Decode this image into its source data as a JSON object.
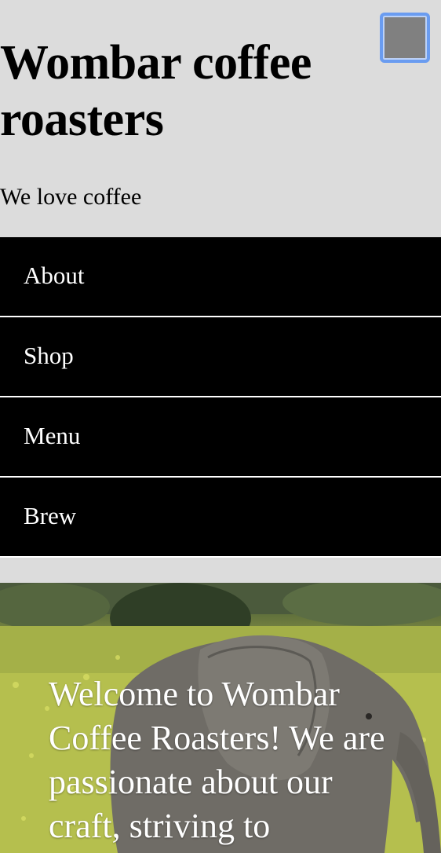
{
  "header": {
    "title": "Wombar coffee roasters",
    "tagline": "We love coffee",
    "menu_toggle_icon": "menu-toggle-icon"
  },
  "nav": {
    "items": [
      {
        "label": "About"
      },
      {
        "label": "Shop"
      },
      {
        "label": "Menu"
      },
      {
        "label": "Brew"
      }
    ]
  },
  "hero": {
    "image_icon": "elephant-photo",
    "text": "Welcome to Wombar Coffee Roasters! We are passionate about our craft, striving to"
  },
  "colors": {
    "page_background": "#dcdcdc",
    "nav_background": "#000000",
    "nav_text": "#ffffff",
    "toggle_fill": "#808080",
    "toggle_focus_ring": "#6a9cf0"
  }
}
